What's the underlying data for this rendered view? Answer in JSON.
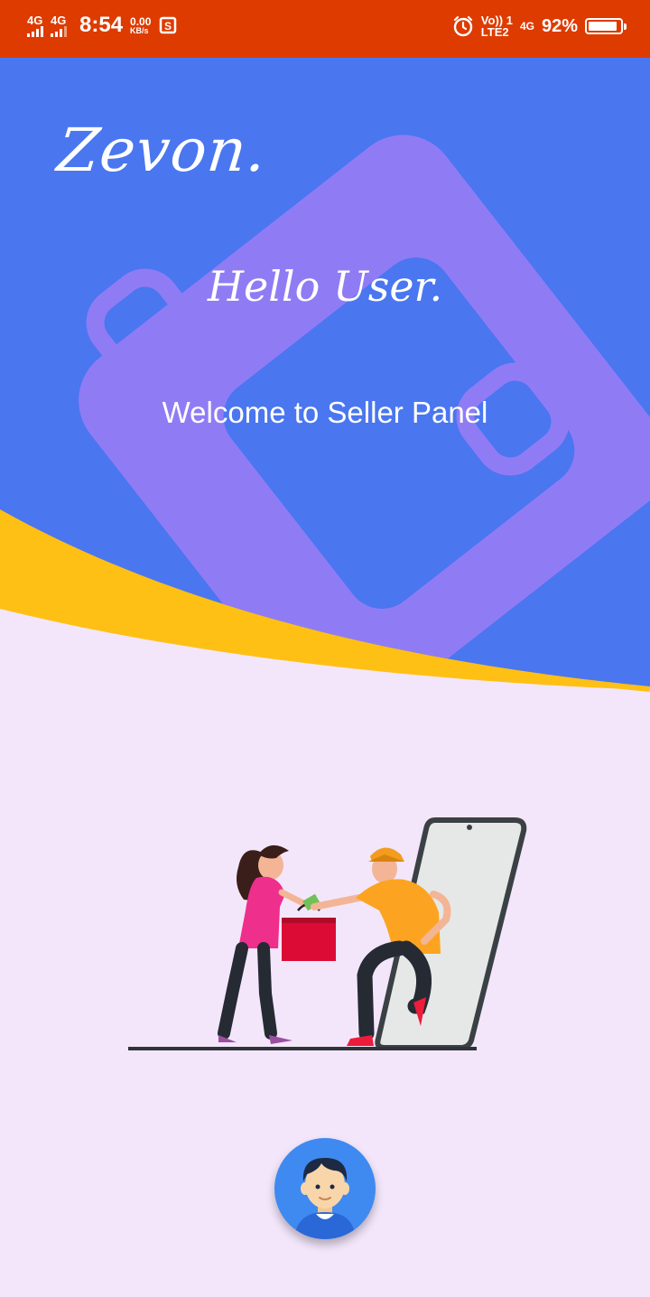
{
  "status_bar": {
    "network_1": "4G",
    "network_2": "4G",
    "time": "8:54",
    "speed_value": "0.00",
    "speed_unit": "KB/s",
    "volte_top": "Vo)) 1",
    "volte_bottom": "LTE2",
    "network_3": "4G",
    "battery_percent": "92%",
    "battery_level": 0.92,
    "icons": [
      "signal-icon",
      "signal-icon",
      "screenshot-icon",
      "alarm-icon",
      "battery-icon"
    ]
  },
  "hero": {
    "brand": "Zevon.",
    "greeting": "Hello User.",
    "subtitle": "Welcome to Seller Panel"
  },
  "illustration": {
    "description_icon": "shopping-delivery-illustration"
  },
  "fab": {
    "icon": "user-avatar-icon"
  },
  "colors": {
    "status_bar": "#de3b00",
    "hero_blue": "#4a76f0",
    "hero_purple": "#8f7cf5",
    "accent_yellow": "#ffc015",
    "background": "#f3e6fb",
    "fab_blue": "#3e8af1"
  }
}
